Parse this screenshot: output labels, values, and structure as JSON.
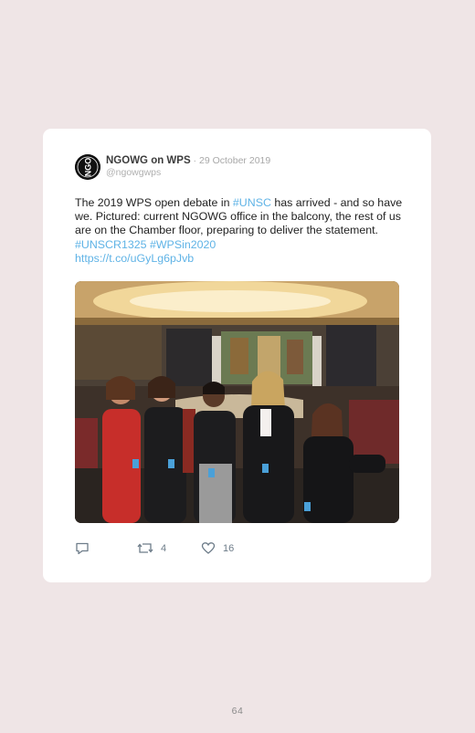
{
  "tweet": {
    "author_name": "NGOWG on WPS",
    "separator": " · ",
    "date": "29 October 2019",
    "handle": "@ngowgwps",
    "avatar_text": "NGO",
    "text": {
      "p1": "The 2019 WPS open debate in ",
      "tag1": "#UNSC",
      "p2": " has arrived - and so have we. Pictured: current NGOWG office in the balcony, the rest of us are on the Chamber floor, preparing to deliver the statement. ",
      "tag2": "#UNSCR1325",
      "space": " ",
      "tag3": "#WPSin2020",
      "link": "https://t.co/uGyLg6pJvb"
    },
    "photo_icon": "group-photo-security-council-chamber",
    "actions": {
      "reply_icon": "reply-icon",
      "retweet_icon": "retweet-icon",
      "retweets": "4",
      "like_icon": "heart-icon",
      "likes": "16"
    }
  },
  "page": {
    "number": "64"
  },
  "colors": {
    "background": "#efe5e6",
    "card": "#ffffff",
    "link": "#5fb3e6",
    "action_gray": "#6d7c89"
  }
}
